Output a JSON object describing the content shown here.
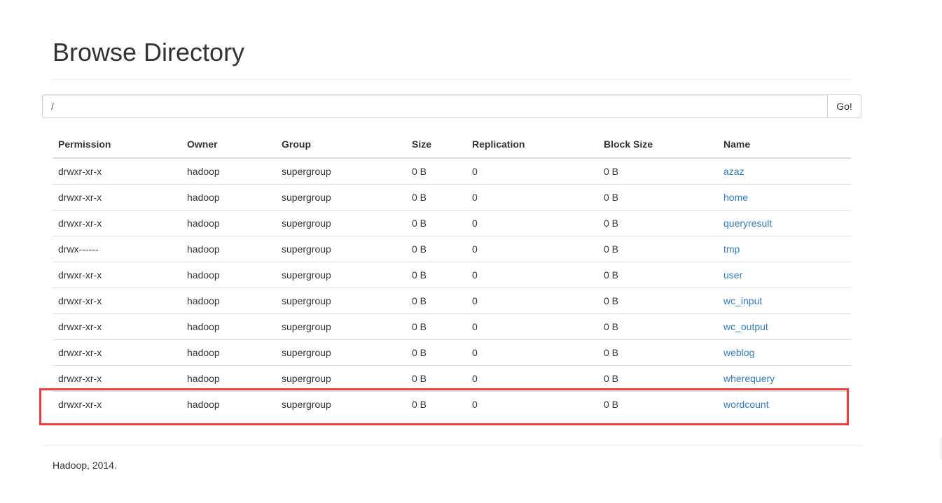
{
  "page": {
    "title": "Browse Directory"
  },
  "path_bar": {
    "value": "/",
    "go_label": "Go!"
  },
  "table": {
    "columns": [
      "Permission",
      "Owner",
      "Group",
      "Size",
      "Replication",
      "Block Size",
      "Name"
    ],
    "rows": [
      {
        "permission": "drwxr-xr-x",
        "owner": "hadoop",
        "group": "supergroup",
        "size": "0 B",
        "replication": "0",
        "block_size": "0 B",
        "name": "azaz"
      },
      {
        "permission": "drwxr-xr-x",
        "owner": "hadoop",
        "group": "supergroup",
        "size": "0 B",
        "replication": "0",
        "block_size": "0 B",
        "name": "home"
      },
      {
        "permission": "drwxr-xr-x",
        "owner": "hadoop",
        "group": "supergroup",
        "size": "0 B",
        "replication": "0",
        "block_size": "0 B",
        "name": "queryresult"
      },
      {
        "permission": "drwx------",
        "owner": "hadoop",
        "group": "supergroup",
        "size": "0 B",
        "replication": "0",
        "block_size": "0 B",
        "name": "tmp"
      },
      {
        "permission": "drwxr-xr-x",
        "owner": "hadoop",
        "group": "supergroup",
        "size": "0 B",
        "replication": "0",
        "block_size": "0 B",
        "name": "user"
      },
      {
        "permission": "drwxr-xr-x",
        "owner": "hadoop",
        "group": "supergroup",
        "size": "0 B",
        "replication": "0",
        "block_size": "0 B",
        "name": "wc_input"
      },
      {
        "permission": "drwxr-xr-x",
        "owner": "hadoop",
        "group": "supergroup",
        "size": "0 B",
        "replication": "0",
        "block_size": "0 B",
        "name": "wc_output"
      },
      {
        "permission": "drwxr-xr-x",
        "owner": "hadoop",
        "group": "supergroup",
        "size": "0 B",
        "replication": "0",
        "block_size": "0 B",
        "name": "weblog"
      },
      {
        "permission": "drwxr-xr-x",
        "owner": "hadoop",
        "group": "supergroup",
        "size": "0 B",
        "replication": "0",
        "block_size": "0 B",
        "name": "wherequery"
      },
      {
        "permission": "drwxr-xr-x",
        "owner": "hadoop",
        "group": "supergroup",
        "size": "0 B",
        "replication": "0",
        "block_size": "0 B",
        "name": "wordcount"
      }
    ],
    "highlighted_row": "wordcount"
  },
  "footer": {
    "text": "Hadoop, 2014."
  },
  "colors": {
    "link": "#337ab7",
    "highlight": "#ef3d3f",
    "text": "#333333",
    "border": "#dddddd"
  }
}
